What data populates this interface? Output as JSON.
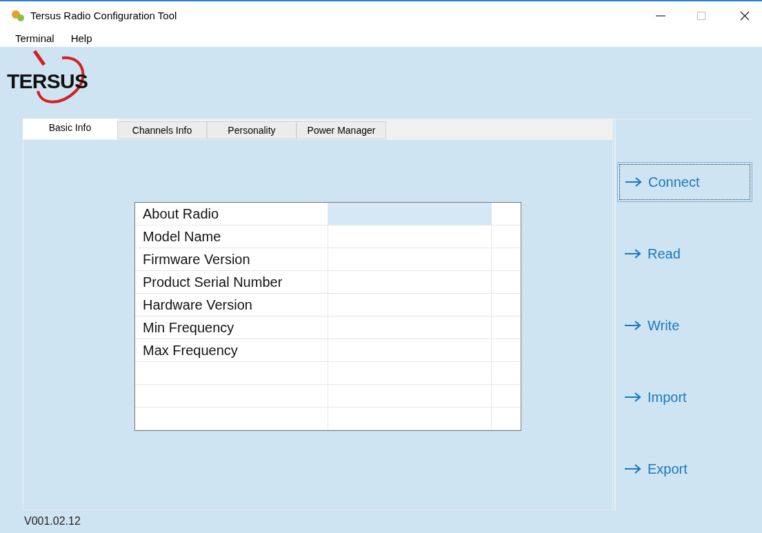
{
  "window": {
    "title": "Tersus Radio Configuration Tool"
  },
  "menu": [
    "Terminal",
    "Help"
  ],
  "logo": {
    "text": "TERSUS"
  },
  "tabs": [
    {
      "label": "Basic Info",
      "selected": true
    },
    {
      "label": "Channels Info",
      "selected": false
    },
    {
      "label": "Personality",
      "selected": false
    },
    {
      "label": "Power Manager",
      "selected": false
    }
  ],
  "table": {
    "rows": [
      {
        "label": "About Radio",
        "selected": true
      },
      {
        "label": "Model Name",
        "selected": false
      },
      {
        "label": "Firmware Version",
        "selected": false
      },
      {
        "label": "Product Serial Number",
        "selected": false
      },
      {
        "label": "Hardware Version",
        "selected": false
      },
      {
        "label": "Min Frequency",
        "selected": false
      },
      {
        "label": "Max Frequency",
        "selected": false
      },
      {
        "selected": false
      },
      {
        "selected": false
      },
      {
        "selected": false
      }
    ]
  },
  "actions": [
    {
      "label": "Connect",
      "focused": true
    },
    {
      "label": "Read",
      "focused": false
    },
    {
      "label": "Write",
      "focused": false
    },
    {
      "label": "Import",
      "focused": false
    },
    {
      "label": "Export",
      "focused": false
    }
  ],
  "status_bar": {
    "version": "V001.02.12"
  }
}
